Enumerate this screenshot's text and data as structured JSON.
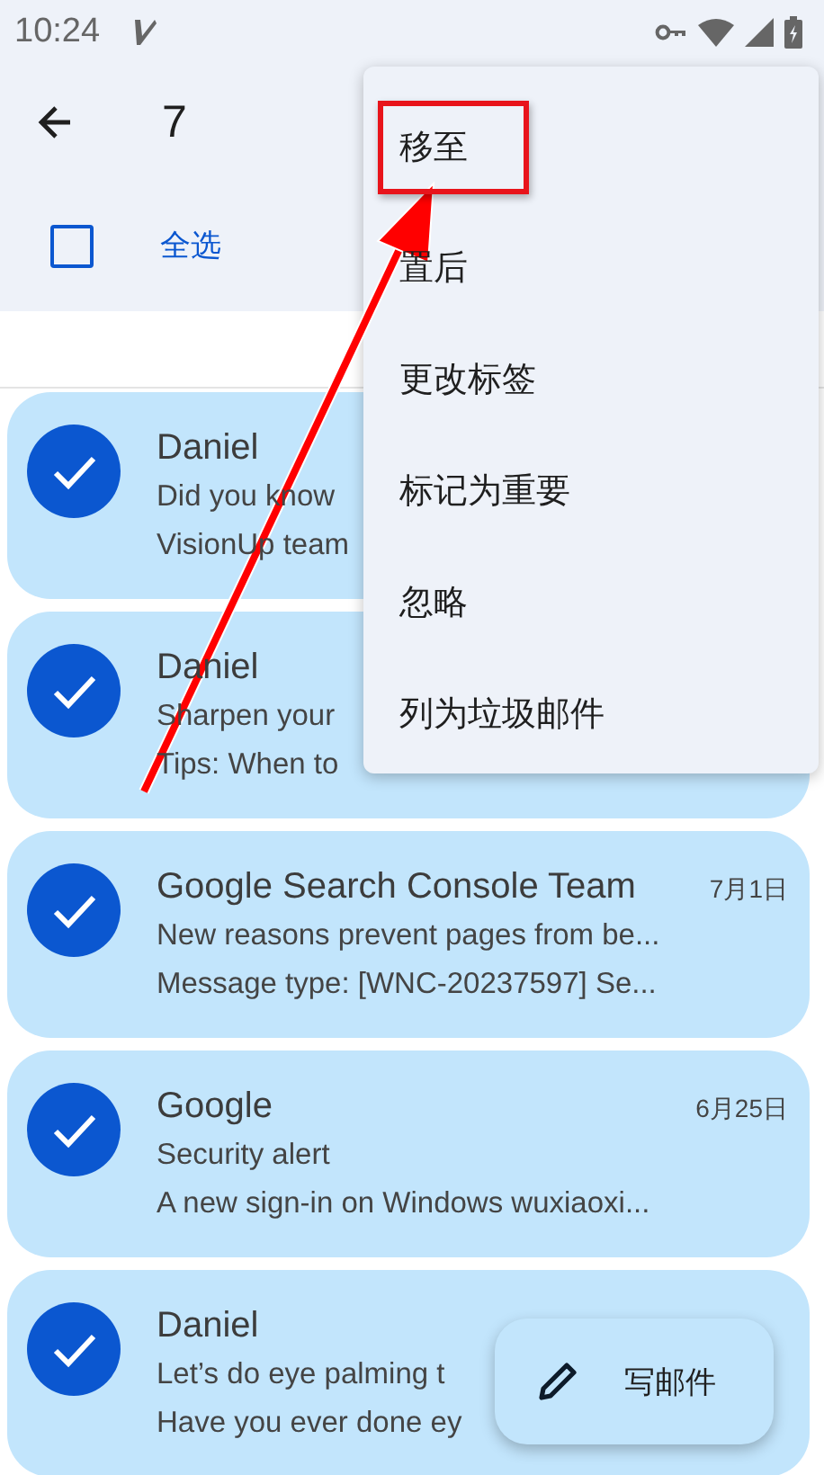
{
  "status_bar": {
    "time": "10:24"
  },
  "header": {
    "count": "7"
  },
  "select_all": {
    "label": "全选",
    "checked": false
  },
  "messages": [
    {
      "sender": "Daniel",
      "subject": "Did you know",
      "preview": "VisionUp team",
      "selected": true
    },
    {
      "sender": "Daniel",
      "subject": "Sharpen your",
      "preview": "Tips: When to",
      "selected": true
    },
    {
      "sender": "Google Search Console Team",
      "date": "7月1日",
      "subject": "New reasons prevent pages from be...",
      "preview": "Message type: [WNC-20237597] Se...",
      "selected": true
    },
    {
      "sender": "Google",
      "date": "6月25日",
      "subject": "Security alert",
      "preview": "A new sign-in on Windows wuxiaoxi...",
      "selected": true
    },
    {
      "sender": "Daniel",
      "subject": "Let’s do eye palming t",
      "preview": "Have you ever done ey",
      "selected": true
    }
  ],
  "menu": {
    "items": [
      {
        "label": "移至",
        "highlighted": true
      },
      {
        "label": "置后",
        "highlighted": false
      },
      {
        "label": "更改标签",
        "highlighted": false
      },
      {
        "label": "标记为重要",
        "highlighted": false
      },
      {
        "label": "忽略",
        "highlighted": false
      },
      {
        "label": "列为垃圾邮件",
        "highlighted": false
      }
    ]
  },
  "compose_button": {
    "label": "写邮件"
  }
}
